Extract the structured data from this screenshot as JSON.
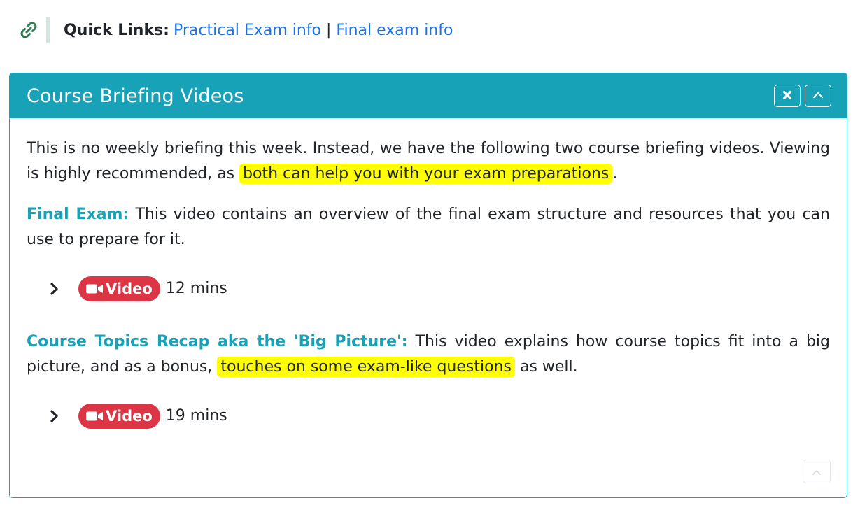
{
  "quick_links": {
    "icon": "link-icon",
    "label": "Quick Links:",
    "links": [
      {
        "label": "Practical Exam info"
      },
      {
        "label": "Final exam info"
      }
    ],
    "separator": "|"
  },
  "card": {
    "title": "Course Briefing Videos",
    "header_buttons": [
      {
        "icon": "close-icon"
      },
      {
        "icon": "chevron-up-icon"
      }
    ],
    "intro": {
      "text_before": "This is no weekly briefing this week. Instead, we have the following two course briefing videos. Viewing is highly recommended, as ",
      "highlight": "both can help you with your exam preparations",
      "text_after": "."
    },
    "sections": [
      {
        "topic": "Final Exam:",
        "text_before": " This video contains an overview of the final exam structure and resources that you can use to prepare for it.",
        "highlight": "",
        "text_after": "",
        "video": {
          "badge": "Video",
          "duration": "12 mins"
        }
      },
      {
        "topic": "Course Topics Recap aka the 'Big Picture':",
        "text_before": " This video explains how course topics fit into a big picture, and as a bonus, ",
        "highlight": "touches on some exam-like questions",
        "text_after": " as well.",
        "video": {
          "badge": "Video",
          "duration": "19 mins"
        }
      }
    ]
  },
  "colors": {
    "accent": "#17a2b8",
    "link": "#1a73e8",
    "badge": "#dc3545",
    "highlight": "#ffff00",
    "link_icon": "#2e7d4f"
  }
}
